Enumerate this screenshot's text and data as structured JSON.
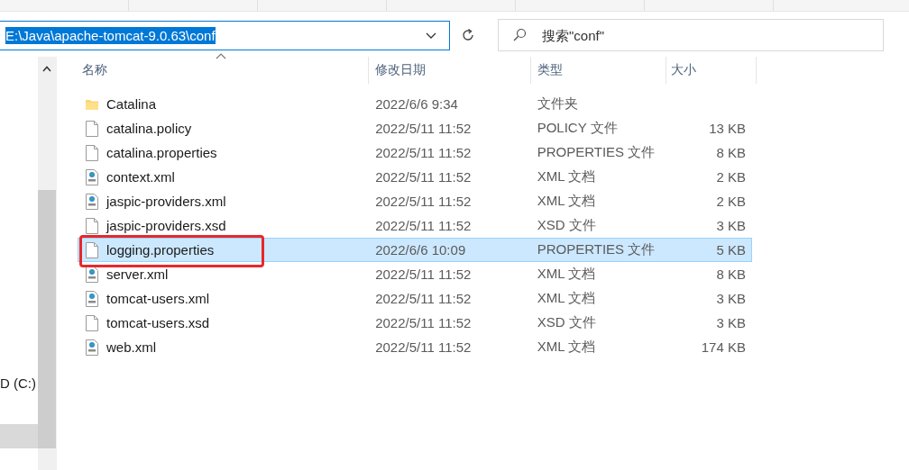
{
  "address_bar": {
    "path": "E:\\Java\\apache-tomcat-9.0.63\\conf",
    "selected": true
  },
  "search": {
    "placeholder": "搜索\"conf\""
  },
  "sidebar": {
    "items": [
      {
        "label": "D (C:)"
      }
    ]
  },
  "table": {
    "columns": [
      {
        "label": "名称",
        "sorted_ascending": true
      },
      {
        "label": "修改日期",
        "sorted_ascending": false
      },
      {
        "label": "类型",
        "sorted_ascending": false
      },
      {
        "label": "大小",
        "sorted_ascending": false
      }
    ],
    "rows": [
      {
        "kind": "folder",
        "name": "Catalina",
        "modified": "2022/6/6 9:34",
        "type": "文件夹",
        "selected": false,
        "highlighted": false
      },
      {
        "kind": "file",
        "name": "catalina.policy",
        "modified": "2022/5/11 11:52",
        "type": "POLICY 文件",
        "size": "13 KB",
        "selected": false,
        "highlighted": false
      },
      {
        "kind": "file",
        "name": "catalina.properties",
        "modified": "2022/5/11 11:52",
        "type": "PROPERTIES 文件",
        "size": "8 KB",
        "selected": false,
        "highlighted": false
      },
      {
        "kind": "xml",
        "name": "context.xml",
        "modified": "2022/5/11 11:52",
        "type": "XML 文档",
        "size": "2 KB",
        "selected": false,
        "highlighted": false
      },
      {
        "kind": "xml",
        "name": "jaspic-providers.xml",
        "modified": "2022/5/11 11:52",
        "type": "XML 文档",
        "size": "2 KB",
        "selected": false,
        "highlighted": false
      },
      {
        "kind": "file",
        "name": "jaspic-providers.xsd",
        "modified": "2022/5/11 11:52",
        "type": "XSD 文件",
        "size": "3 KB",
        "selected": false,
        "highlighted": false
      },
      {
        "kind": "file",
        "name": "logging.properties",
        "modified": "2022/6/6 10:09",
        "type": "PROPERTIES 文件",
        "size": "5 KB",
        "selected": true,
        "highlighted": true
      },
      {
        "kind": "xml",
        "name": "server.xml",
        "modified": "2022/5/11 11:52",
        "type": "XML 文档",
        "size": "8 KB",
        "selected": false,
        "highlighted": false
      },
      {
        "kind": "xml",
        "name": "tomcat-users.xml",
        "modified": "2022/5/11 11:52",
        "type": "XML 文档",
        "size": "3 KB",
        "selected": false,
        "highlighted": false
      },
      {
        "kind": "file",
        "name": "tomcat-users.xsd",
        "modified": "2022/5/11 11:52",
        "type": "XSD 文件",
        "size": "3 KB",
        "selected": false,
        "highlighted": false
      },
      {
        "kind": "xml",
        "name": "web.xml",
        "modified": "2022/5/11 11:52",
        "type": "XML 文档",
        "size": "174 KB",
        "selected": false,
        "highlighted": false
      }
    ]
  }
}
